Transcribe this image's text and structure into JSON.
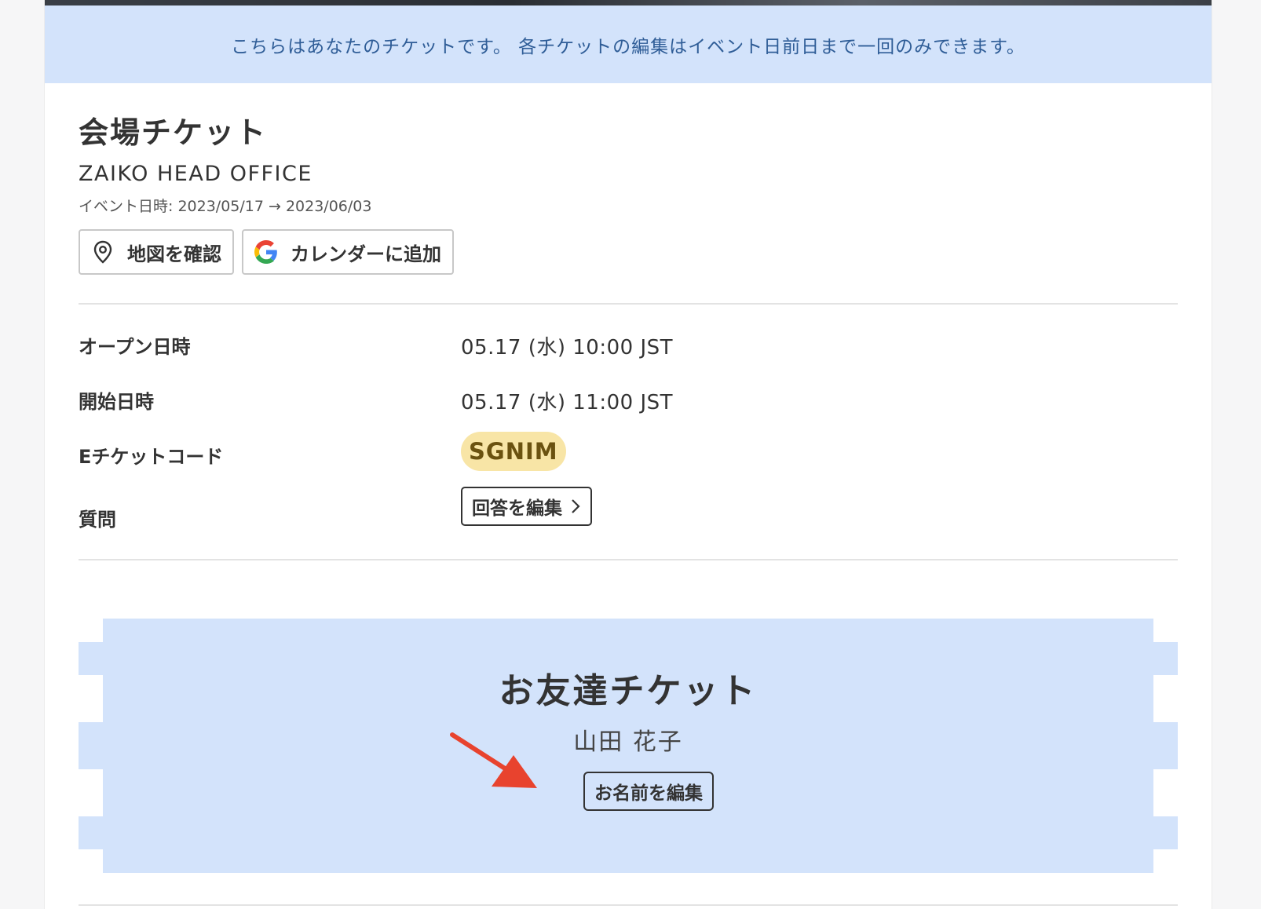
{
  "notice": {
    "text": "こちらはあなたのチケットです。 各チケットの編集はイベント日前日まで一回のみできます。"
  },
  "ticket": {
    "title": "会場チケット",
    "venue": "ZAIKO HEAD OFFICE",
    "event_date": "イベント日時: 2023/05/17 → 2023/06/03",
    "map_button": "地図を確認",
    "calendar_button": "カレンダーに追加"
  },
  "details": {
    "open_label": "オープン日時",
    "open_value": "05.17 (水) 10:00 JST",
    "start_label": "開始日時",
    "start_value": "05.17 (水) 11:00 JST",
    "code_label": "Eチケットコード",
    "code_value": "SGNIM",
    "question_label": "質問",
    "question_button": "回答を編集"
  },
  "friend_ticket": {
    "title": "お友達チケット",
    "name": "山田 花子",
    "edit_button": "お名前を編集"
  },
  "colors": {
    "notice_bg": "#d3e3fb",
    "notice_text": "#2f5d97",
    "code_badge_bg": "#f8e5a6",
    "code_badge_text": "#6b5210",
    "arrow": "#e8432e"
  },
  "icons": {
    "map": "map-pin-icon",
    "calendar": "google-icon",
    "chevron": "chevron-right-icon"
  }
}
